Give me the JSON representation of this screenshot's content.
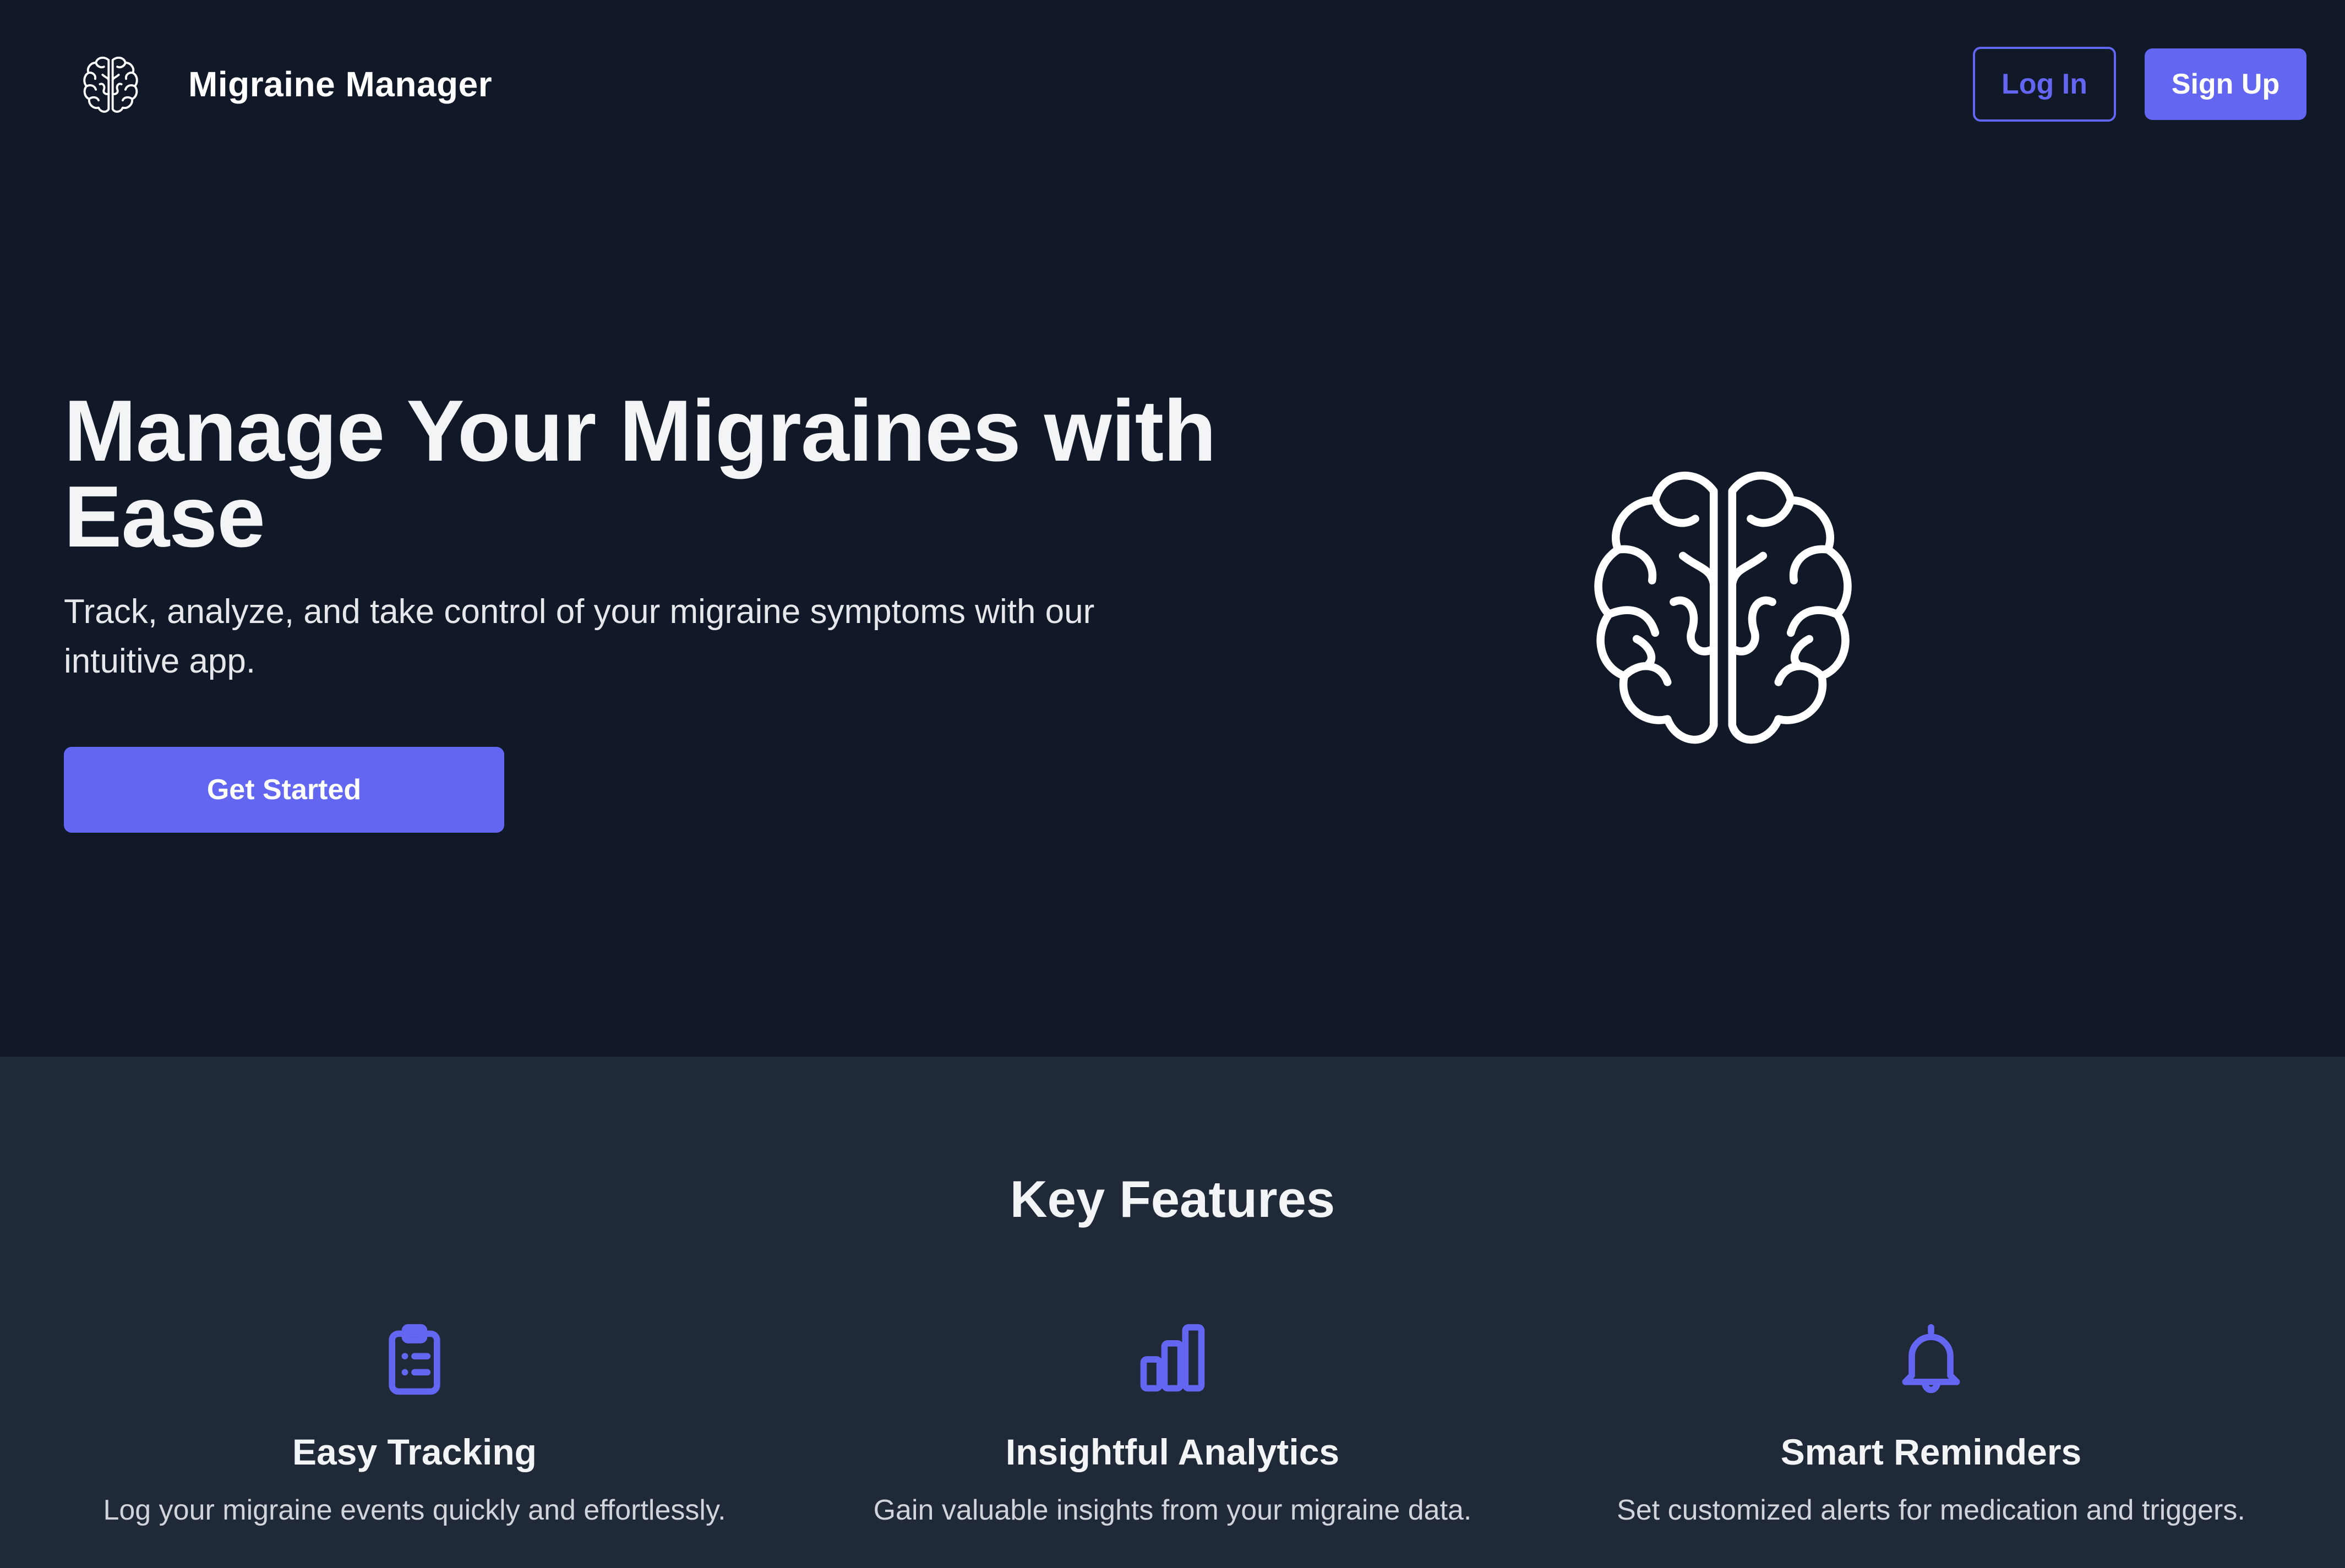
{
  "header": {
    "logo_icon": "brain-icon",
    "app_name": "Migraine Manager",
    "login_label": "Log In",
    "signup_label": "Sign Up"
  },
  "hero": {
    "title": "Manage Your Migraines with Ease",
    "subtitle": "Track, analyze, and take control of your migraine symptoms with our intuitive app.",
    "cta_label": "Get Started",
    "illustration_icon": "brain-icon"
  },
  "features": {
    "heading": "Key Features",
    "items": [
      {
        "icon": "clipboard-list-icon",
        "title": "Easy Tracking",
        "description": "Log your migraine events quickly and effortlessly."
      },
      {
        "icon": "bar-chart-icon",
        "title": "Insightful Analytics",
        "description": "Gain valuable insights from your migraine data."
      },
      {
        "icon": "bell-icon",
        "title": "Smart Reminders",
        "description": "Set customized alerts for medication and triggers."
      }
    ]
  },
  "colors": {
    "page_background": "#111827",
    "features_background": "#1f2937",
    "accent": "#6366f1",
    "text_primary": "#f3f4f6"
  }
}
